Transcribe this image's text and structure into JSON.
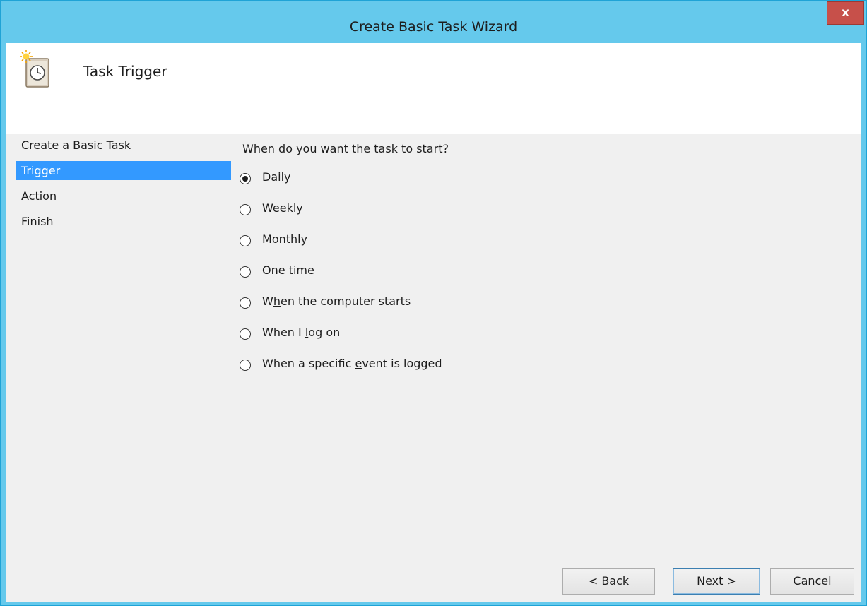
{
  "window": {
    "title": "Create Basic Task Wizard",
    "close_label": "x"
  },
  "header": {
    "title": "Task Trigger",
    "icon": "task-scheduler-clock-icon"
  },
  "steps": [
    "Create a Basic Task",
    "Trigger",
    "Action",
    "Finish"
  ],
  "active_step": "Trigger",
  "question": "When do you want the task to start?",
  "options": [
    {
      "pre": "",
      "key": "D",
      "post": "aily",
      "selected": true
    },
    {
      "pre": "",
      "key": "W",
      "post": "eekly",
      "selected": false
    },
    {
      "pre": "",
      "key": "M",
      "post": "onthly",
      "selected": false
    },
    {
      "pre": "",
      "key": "O",
      "post": "ne time",
      "selected": false
    },
    {
      "pre": "W",
      "key": "h",
      "post": "en the computer starts",
      "selected": false
    },
    {
      "pre": "When I ",
      "key": "l",
      "post": "og on",
      "selected": false
    },
    {
      "pre": "When a specific ",
      "key": "e",
      "post": "vent is logged",
      "selected": false
    }
  ],
  "buttons": {
    "back": {
      "pre": "< ",
      "key": "B",
      "post": "ack"
    },
    "next": {
      "pre": "",
      "key": "N",
      "post": "ext >"
    },
    "cancel": "Cancel"
  },
  "colors": {
    "titlebar": "#65c9ec",
    "close": "#c7504a",
    "selection": "#3399ff",
    "client": "#f0f0f0"
  }
}
